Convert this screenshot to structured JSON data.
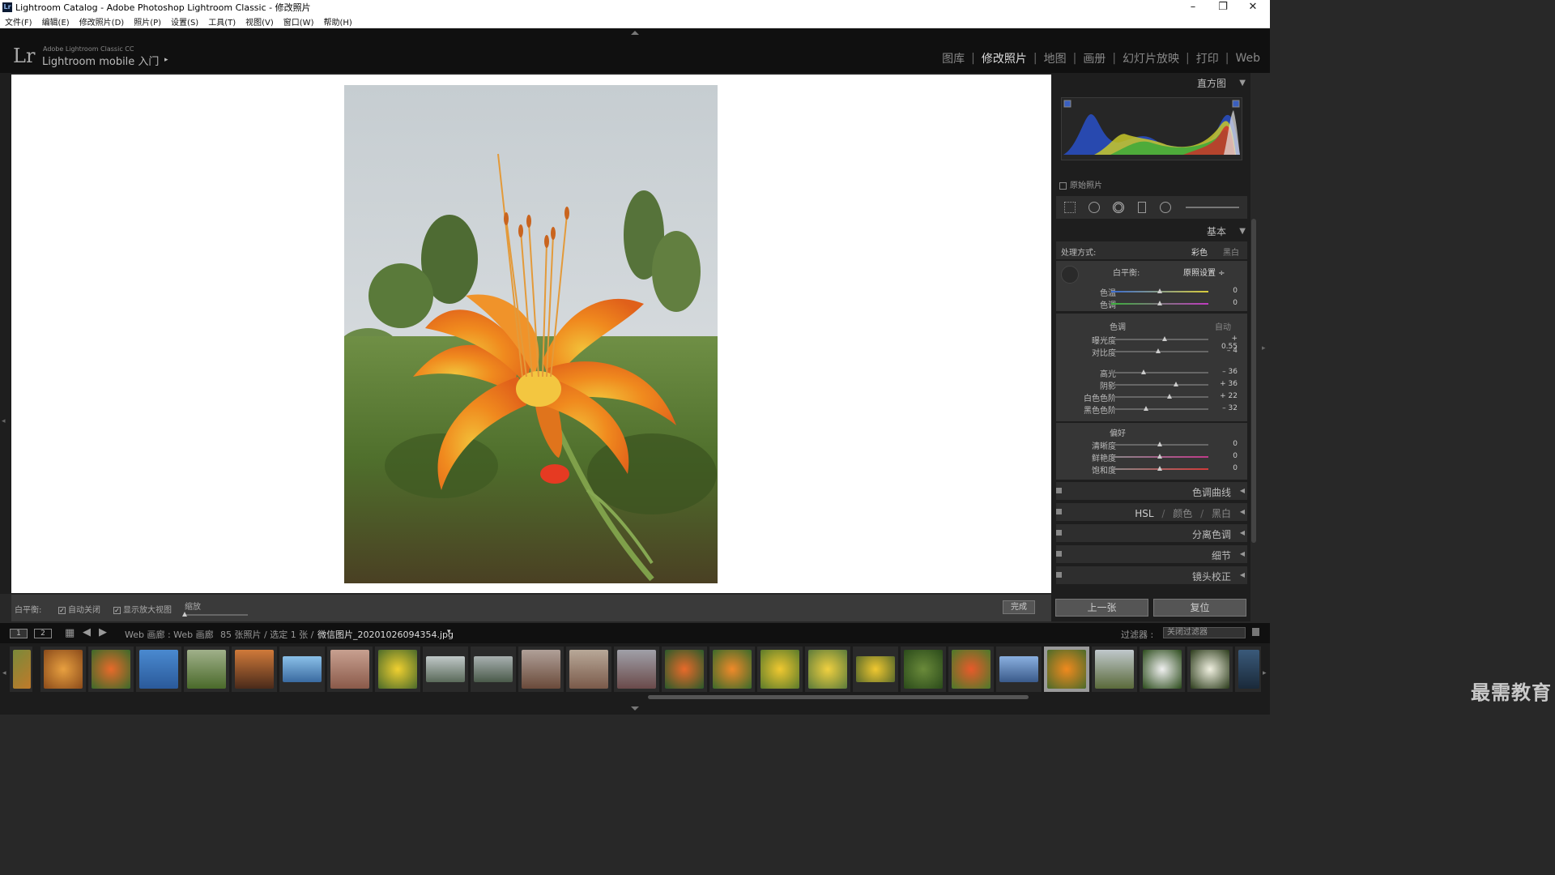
{
  "window": {
    "title": "Lightroom Catalog - Adobe Photoshop Lightroom Classic - 修改照片",
    "app_icon": "Lr"
  },
  "menu": [
    "文件(F)",
    "编辑(E)",
    "修改照片(D)",
    "照片(P)",
    "设置(S)",
    "工具(T)",
    "视图(V)",
    "窗口(W)",
    "帮助(H)"
  ],
  "brand": {
    "logo": "Lr",
    "line1": "Adobe Lightroom Classic CC",
    "line2": "Lightroom mobile 入门",
    "arrow": "▸"
  },
  "modules": [
    {
      "label": "图库",
      "active": false
    },
    {
      "label": "修改照片",
      "active": true
    },
    {
      "label": "地图",
      "active": false
    },
    {
      "label": "画册",
      "active": false
    },
    {
      "label": "幻灯片放映",
      "active": false
    },
    {
      "label": "打印",
      "active": false
    },
    {
      "label": "Web",
      "active": false
    }
  ],
  "toolbar": {
    "wb_label": "白平衡:",
    "auto_close": "自动关闭",
    "show_loupe": "显示放大视图",
    "zoom_label": "缩放",
    "done": "完成"
  },
  "panel": {
    "histogram_title": "直方图",
    "original_photo": "原始照片",
    "basic_title": "基本",
    "treatment_label": "处理方式:",
    "treatment_color": "彩色",
    "treatment_bw": "黑白",
    "wb_label": "白平衡:",
    "wb_value": "原照设置 ÷",
    "temp": {
      "label": "色温",
      "value": "0",
      "pos": 0.5
    },
    "tint": {
      "label": "色调",
      "value": "0",
      "pos": 0.5
    },
    "tone_title": "色调",
    "tone_auto": "自动",
    "exposure": {
      "label": "曝光度",
      "value": "+ 0.55",
      "pos": 0.55
    },
    "contrast": {
      "label": "对比度",
      "value": "– 4",
      "pos": 0.48
    },
    "highlights": {
      "label": "高光",
      "value": "– 36",
      "pos": 0.33
    },
    "shadows": {
      "label": "阴影",
      "value": "+ 36",
      "pos": 0.67
    },
    "whites": {
      "label": "白色色阶",
      "value": "+ 22",
      "pos": 0.6
    },
    "blacks": {
      "label": "黑色色阶",
      "value": "– 32",
      "pos": 0.36
    },
    "presence_title": "偏好",
    "clarity": {
      "label": "清晰度",
      "value": "0",
      "pos": 0.5
    },
    "vibrance": {
      "label": "鲜艳度",
      "value": "0",
      "pos": 0.5
    },
    "saturation": {
      "label": "饱和度",
      "value": "0",
      "pos": 0.5
    },
    "tone_curve": "色调曲线",
    "hsl_parts": [
      "HSL",
      "/",
      "颜色",
      "/",
      "黑白"
    ],
    "split_toning": "分离色调",
    "detail": "细节",
    "lens": "镜头校正",
    "prev": "上一张",
    "reset": "复位"
  },
  "filmbar": {
    "page1": "1",
    "page2": "2",
    "source": "Web 画廊 : Web 画廊",
    "count": "85 张照片 / 选定 1 张 /",
    "filename": "微信图片_20201026094354.jpg",
    "filename_arrow": "▾",
    "filter_label": "过滤器 :",
    "filter_value": "关闭过滤器"
  },
  "watermark": "最需教育",
  "colors": {
    "accent_bg": "#1e1e1e",
    "panel": "#363636",
    "text": "#bbbbbb"
  }
}
